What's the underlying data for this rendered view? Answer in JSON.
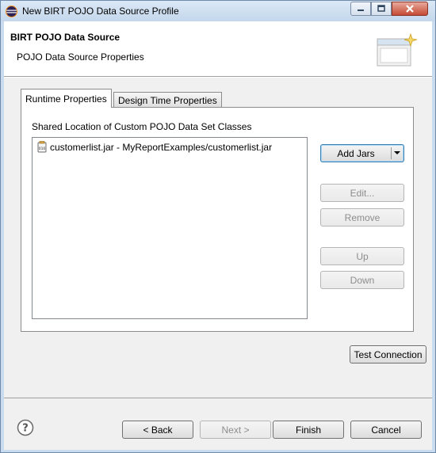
{
  "window": {
    "title": "New BIRT POJO Data Source Profile"
  },
  "header": {
    "title": "BIRT POJO Data Source",
    "subtitle": "POJO Data Source Properties",
    "graphic_icon": "wizard-banner-icon"
  },
  "tabs": [
    {
      "label": "Runtime Properties",
      "active": true
    },
    {
      "label": "Design Time Properties",
      "active": false
    }
  ],
  "runtime": {
    "section_label": "Shared Location of Custom POJO Data Set Classes",
    "jar_items": [
      {
        "icon": "jar-file-icon",
        "label": "customerlist.jar - MyReportExamples/customerlist.jar"
      }
    ],
    "buttons": {
      "add_jars": "Add Jars",
      "edit": "Edit...",
      "remove": "Remove",
      "up": "Up",
      "down": "Down"
    }
  },
  "test_connection_label": "Test Connection",
  "footer": {
    "help_icon": "help-icon",
    "back_label": "< Back",
    "next_label": "Next >",
    "finish_label": "Finish",
    "cancel_label": "Cancel"
  }
}
